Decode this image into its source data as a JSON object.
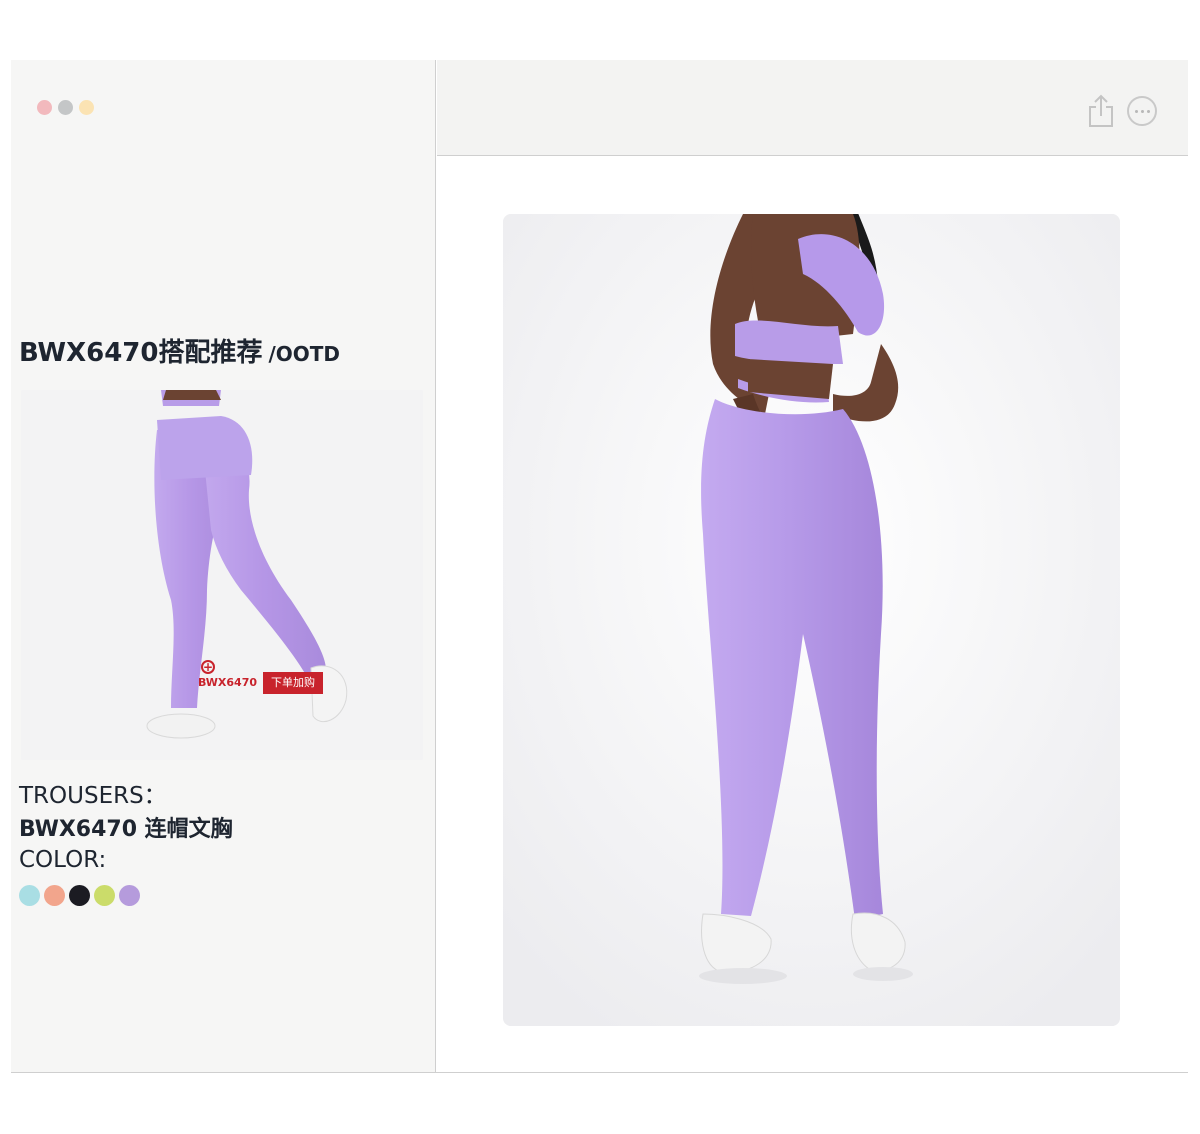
{
  "window": {
    "controls": [
      "close",
      "minimize",
      "zoom"
    ]
  },
  "left": {
    "title": "BWX6470搭配推荐",
    "title_suffix": "/OOTD",
    "thumb_tag_code": "BWX6470",
    "thumb_tag_button": "下单加购",
    "trousers_label": "TROUSERS：",
    "product_label": "BWX6470 连帽文胸",
    "color_label": "COLOR:",
    "colors": [
      "#a9dee4",
      "#f2a58c",
      "#1b1b22",
      "#cbdc6a",
      "#b59bdc"
    ]
  },
  "toolbar": {
    "share_icon": "share-icon",
    "more_icon": "more-icon"
  }
}
